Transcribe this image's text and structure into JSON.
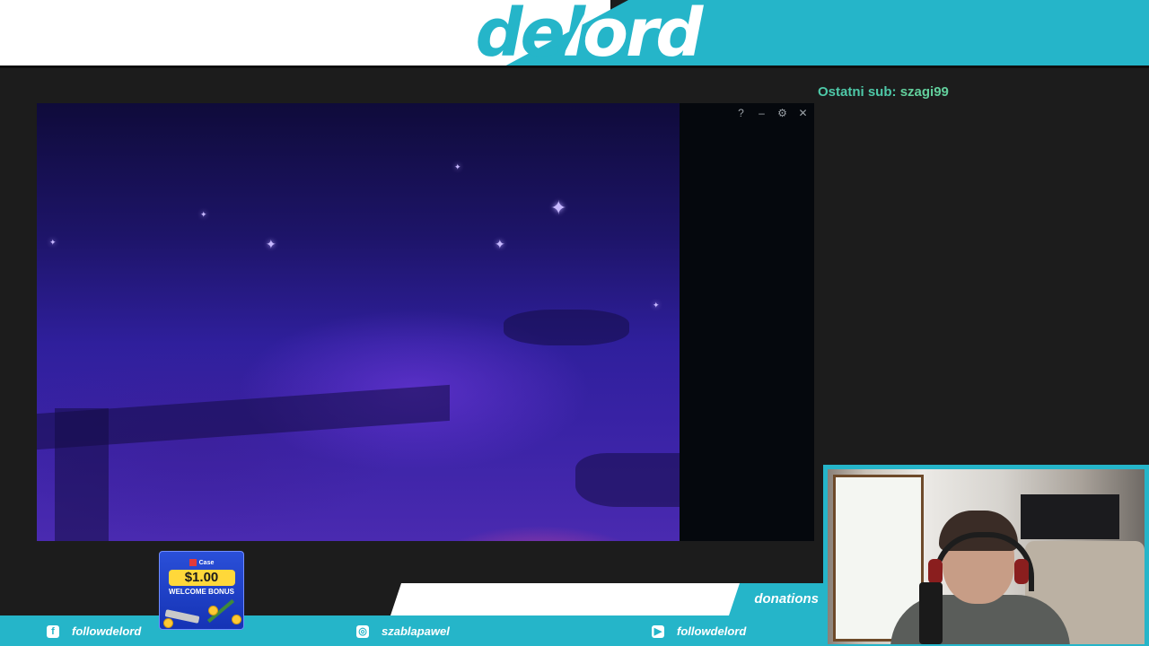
{
  "header": {
    "logo_text": "delord"
  },
  "last_sub": {
    "label": "Ostatni sub:",
    "name": "szagi99"
  },
  "game_window": {
    "controls": {
      "help": "?",
      "minimize": "–",
      "settings": "⚙",
      "close": "✕"
    }
  },
  "promo": {
    "brand": "Case",
    "amount": "$1.00",
    "bonus": "WELCOME BONUS"
  },
  "bottom_bar": {
    "donations_label": "donations",
    "socials": [
      {
        "icon": "facebook-icon",
        "glyph": "f",
        "handle": "followdelord"
      },
      {
        "icon": "instagram-icon",
        "glyph": "◎",
        "handle": "szablapawel"
      },
      {
        "icon": "youtube-icon",
        "glyph": "▶",
        "handle": "followdelord"
      }
    ]
  },
  "colors": {
    "accent": "#25b5c9",
    "background": "#1c1c1c",
    "sub_text": "#4ec9a8"
  }
}
